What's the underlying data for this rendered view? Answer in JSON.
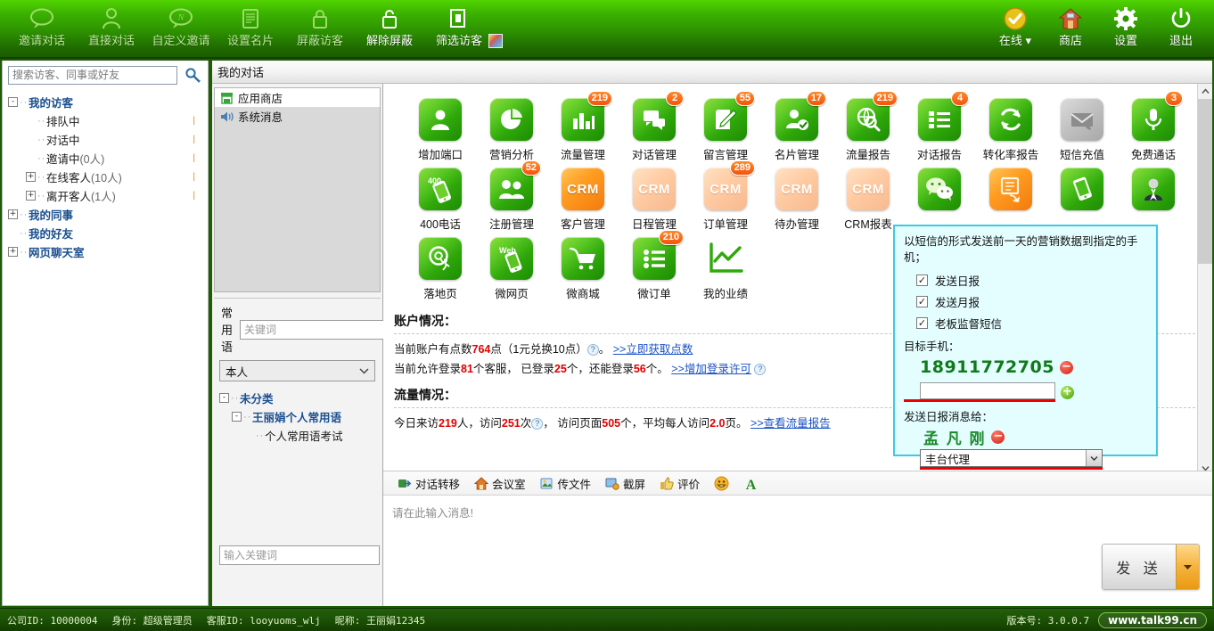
{
  "toolbar": {
    "left_items": [
      {
        "label": "邀请对话",
        "icon": "speech-bubble-icon",
        "active": false
      },
      {
        "label": "直接对话",
        "icon": "person-icon",
        "active": false
      },
      {
        "label": "自定义邀请",
        "icon": "custom-invite-icon",
        "active": false
      },
      {
        "label": "设置名片",
        "icon": "card-icon",
        "active": false
      },
      {
        "label": "屏蔽访客",
        "icon": "lock-closed-icon",
        "active": false
      },
      {
        "label": "解除屏蔽",
        "icon": "lock-open-icon",
        "active": true
      },
      {
        "label": "筛选访客",
        "icon": "filter-windows-icon",
        "active": true
      }
    ],
    "extra_icon": "color-palette-icon",
    "right_items": [
      {
        "label": "在线 ▾",
        "icon": "online-check-icon"
      },
      {
        "label": "商店",
        "icon": "home-shop-icon"
      },
      {
        "label": "设置",
        "icon": "gear-icon"
      },
      {
        "label": "退出",
        "icon": "power-icon"
      }
    ]
  },
  "sidebar": {
    "search_placeholder": "搜索访客、同事或好友",
    "search_value": "",
    "search_icon": "magnifier-icon",
    "tree": [
      {
        "label": "我的访客",
        "toggle": "-",
        "level": 1,
        "bold": true,
        "count": "",
        "tick": ""
      },
      {
        "label": "排队中",
        "toggle": "",
        "level": 2,
        "bold": false,
        "count": "",
        "tick": "|"
      },
      {
        "label": "对话中",
        "toggle": "",
        "level": 2,
        "bold": false,
        "count": "",
        "tick": "|"
      },
      {
        "label": "邀请中",
        "toggle": "",
        "level": 2,
        "bold": false,
        "count": " (0人)",
        "tick": "|"
      },
      {
        "label": "在线客人",
        "toggle": "+",
        "level": 2,
        "bold": false,
        "count": " (10人)",
        "tick": "|"
      },
      {
        "label": "离开客人",
        "toggle": "+",
        "level": 2,
        "bold": false,
        "count": " (1人)",
        "tick": "|"
      },
      {
        "label": "我的同事",
        "toggle": "+",
        "level": 1,
        "bold": true,
        "count": "",
        "tick": ""
      },
      {
        "label": "我的好友",
        "toggle": "",
        "level": 1,
        "bold": true,
        "count": "",
        "tick": ""
      },
      {
        "label": "网页聊天室",
        "toggle": "+",
        "level": 1,
        "bold": true,
        "count": "",
        "tick": ""
      }
    ]
  },
  "midcol": {
    "items": [
      {
        "label": "应用商店",
        "icon": "shop-icon",
        "selected": true
      },
      {
        "label": "系统消息",
        "icon": "speaker-icon",
        "selected": false
      }
    ],
    "phrase_title": "常用语",
    "keyword_placeholder": "关键词",
    "keyword_value": "",
    "owner_select": "本人",
    "phrase_tree": [
      {
        "label": "未分类",
        "toggle": "-",
        "level": 1,
        "bold": true
      },
      {
        "label": "王丽娟个人常用语",
        "toggle": "-",
        "level": 2,
        "bold": true
      },
      {
        "label": "个人常用语考试",
        "toggle": "",
        "level": 3,
        "bold": false
      }
    ],
    "bottom_keyword_placeholder": "输入关键词",
    "bottom_keyword_value": ""
  },
  "pane": {
    "title": "我的对话"
  },
  "apps": {
    "rows": [
      [
        {
          "caption": "增加端口",
          "style": "green",
          "badge": "",
          "glyph": "person-icon"
        },
        {
          "caption": "营销分析",
          "style": "green",
          "badge": "",
          "glyph": "pie-chart-icon"
        },
        {
          "caption": "流量管理",
          "style": "green",
          "badge": "219",
          "glyph": "bar-chart-icon"
        },
        {
          "caption": "对话管理",
          "style": "green",
          "badge": "2",
          "glyph": "chat-icon"
        },
        {
          "caption": "留言管理",
          "style": "green",
          "badge": "55",
          "glyph": "note-pencil-icon"
        },
        {
          "caption": "名片管理",
          "style": "green",
          "badge": "17",
          "glyph": "person-check-icon"
        },
        {
          "caption": "流量报告",
          "style": "green",
          "badge": "219",
          "glyph": "globe-search-icon"
        },
        {
          "caption": "对话报告",
          "style": "green",
          "badge": "4",
          "glyph": "list-icon"
        },
        {
          "caption": "转化率报告",
          "style": "green",
          "badge": "",
          "glyph": "refresh-icon"
        },
        {
          "caption": "短信充值",
          "style": "gray",
          "badge": "",
          "glyph": "envelope-icon"
        },
        {
          "caption": "免费通话",
          "style": "green",
          "badge": "3",
          "glyph": "microphone-icon"
        }
      ],
      [
        {
          "caption": "400电话",
          "style": "green",
          "badge": "",
          "glyph": "phone-400-icon"
        },
        {
          "caption": "注册管理",
          "style": "green",
          "badge": "52",
          "glyph": "two-people-icon"
        },
        {
          "caption": "客户管理",
          "style": "orange",
          "badge": "",
          "glyph": "crm-text"
        },
        {
          "caption": "日程管理",
          "style": "pale",
          "badge": "",
          "glyph": "crm-text"
        },
        {
          "caption": "订单管理",
          "style": "pale",
          "badge": "289",
          "glyph": "crm-text"
        },
        {
          "caption": "待办管理",
          "style": "pale",
          "badge": "",
          "glyph": "crm-text"
        },
        {
          "caption": "CRM报表",
          "style": "pale",
          "badge": "",
          "glyph": "crm-text"
        },
        {
          "caption": "",
          "style": "green",
          "badge": "",
          "glyph": "wechat-icon"
        },
        {
          "caption": "",
          "style": "orange",
          "badge": "",
          "glyph": "sms-reply-icon"
        },
        {
          "caption": "",
          "style": "green",
          "badge": "",
          "glyph": "mobile-card-icon"
        },
        {
          "caption": "",
          "style": "green",
          "badge": "",
          "glyph": "manager-icon"
        }
      ],
      [
        {
          "caption": "落地页",
          "style": "green",
          "badge": "",
          "glyph": "at-landing-icon"
        },
        {
          "caption": "微网页",
          "style": "green",
          "badge": "",
          "glyph": "web-mobile-icon"
        },
        {
          "caption": "微商城",
          "style": "green",
          "badge": "",
          "glyph": "cart-icon"
        },
        {
          "caption": "微订单",
          "style": "green",
          "badge": "210",
          "glyph": "list-dot-icon"
        },
        {
          "caption": "我的业绩",
          "style": "white",
          "badge": "",
          "glyph": "trend-chart-icon"
        }
      ]
    ]
  },
  "account": {
    "section1_title": "账户情况：",
    "line1_a": "当前账户有点数",
    "line1_points": "764",
    "line1_b": "点（1元兑换10点）",
    "line1_c": "。",
    "line1_link": ">>立即获取点数",
    "line2_a": "当前允许登录",
    "line2_allowed": "81",
    "line2_b": "个客服， 已登录",
    "line2_logged": "25",
    "line2_c": "个，还能登录",
    "line2_remain": "56",
    "line2_d": "个。",
    "line2_link": ">>增加登录许可",
    "section2_title": "流量情况：",
    "line3_a": "今日来访",
    "line3_visitors": "219",
    "line3_b": "人，访问",
    "line3_visits": "251",
    "line3_c": "次",
    "line3_d": "， 访问页面",
    "line3_pages": "505",
    "line3_e": "个，平均每人访问",
    "line3_avg": "2.0",
    "line3_f": "页。",
    "line3_link": ">>查看流量报告"
  },
  "tooltip": {
    "description": "以短信的形式发送前一天的营销数据到指定的手机；",
    "checkboxes": [
      {
        "label": "发送日报",
        "checked": true
      },
      {
        "label": "发送月报",
        "checked": true
      },
      {
        "label": "老板监督短信",
        "checked": true
      }
    ],
    "target_phone_label": "目标手机：",
    "phone_value": "18911772705",
    "phone_remove_icon": "remove-circle-icon",
    "phone_input_value": "",
    "phone_add_icon": "add-circle-icon",
    "report_to_label": "发送日报消息给：",
    "recipient_name": "孟 凡 刚",
    "recipient_remove_icon": "remove-circle-icon",
    "agent_select_value": "丰台代理"
  },
  "chatbar": {
    "items": [
      {
        "label": "对话转移",
        "icon": "transfer-icon"
      },
      {
        "label": "会议室",
        "icon": "house-icon"
      },
      {
        "label": "传文件",
        "icon": "file-image-icon"
      },
      {
        "label": "截屏",
        "icon": "screenshot-icon"
      },
      {
        "label": "评价",
        "icon": "thumb-icon"
      }
    ],
    "emoji_icon": "smiley-icon",
    "font_icon": "font-A-icon",
    "input_placeholder": "请在此输入消息!",
    "input_value": "",
    "send_label": "发 送",
    "send_dropdown_icon": "caret-down-icon"
  },
  "statusbar": {
    "company_id": "公司ID: 10000004",
    "role": "身份: 超级管理员",
    "agent_id": "客服ID: looyuoms_wlj",
    "nickname": "昵称: 王丽娟12345",
    "version": "版本号: 3.0.0.7",
    "site": "www.talk99.cn"
  },
  "scrollbar": {
    "up_icon": "chevron-up-icon",
    "down_icon": "chevron-down-icon"
  },
  "colors": {
    "brand_green": "#2e9500",
    "badge_orange": "#f4530a",
    "link_blue": "#1a52c4",
    "number_red": "#e00000",
    "tooltip_border": "#3fc8e0",
    "tooltip_bg": "#e4feff",
    "phone_green": "#0f7a1a"
  }
}
